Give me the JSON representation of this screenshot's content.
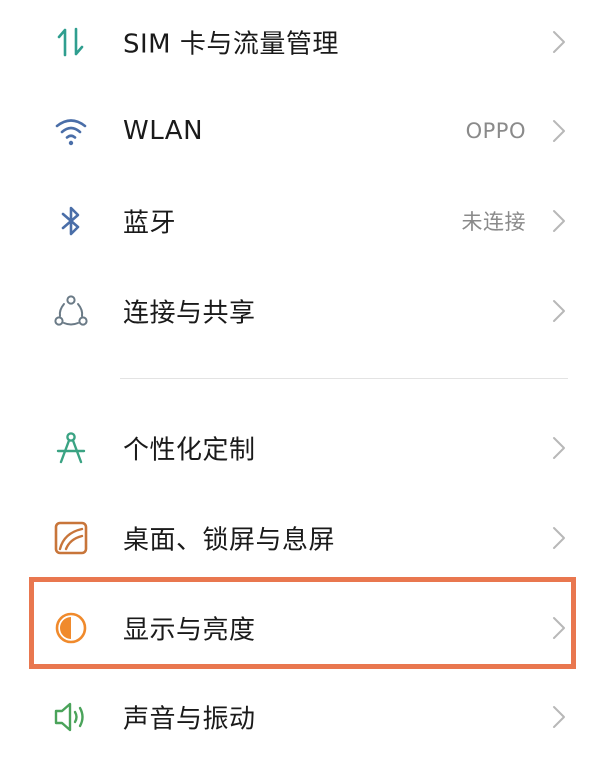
{
  "settings": {
    "items": [
      {
        "label": "SIM 卡与流量管理",
        "value": "",
        "icon": "data-transfer-icon",
        "color": "#2f9e8f"
      },
      {
        "label": "WLAN",
        "value": "OPPO",
        "icon": "wifi-icon",
        "color": "#4a6ea8"
      },
      {
        "label": "蓝牙",
        "value": "未连接",
        "icon": "bluetooth-icon",
        "color": "#4a6ea8"
      },
      {
        "label": "连接与共享",
        "value": "",
        "icon": "connection-share-icon",
        "color": "#6a7a86"
      },
      {
        "label": "个性化定制",
        "value": "",
        "icon": "compass-icon",
        "color": "#3aa383"
      },
      {
        "label": "桌面、锁屏与息屏",
        "value": "",
        "icon": "wallpaper-icon",
        "color": "#c8753a"
      },
      {
        "label": "显示与亮度",
        "value": "",
        "icon": "brightness-icon",
        "color": "#f08a2c"
      },
      {
        "label": "声音与振动",
        "value": "",
        "icon": "speaker-icon",
        "color": "#4aa35a"
      }
    ]
  },
  "highlight_color": "#e9774f",
  "chevron_icon": "chevron-right-icon"
}
